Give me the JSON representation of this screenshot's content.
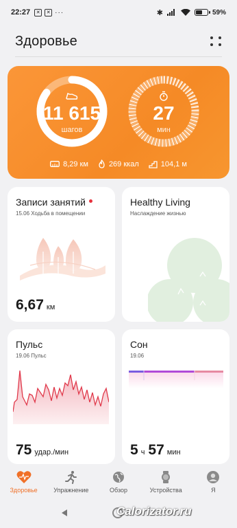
{
  "status_bar": {
    "time": "22:27",
    "battery": "59%",
    "battery_level": 0.59
  },
  "header": {
    "title": "Здоровье"
  },
  "activity": {
    "steps_value": "11 615",
    "steps_unit": "шагов",
    "minutes_value": "27",
    "minutes_unit": "мин",
    "distance": "8,29 км",
    "calories": "269 ккал",
    "floors": "104,1 м",
    "steps_progress": 0.85,
    "minutes_progress": 0.9,
    "accent": "#f58a26"
  },
  "workouts_card": {
    "title": "Записи занятий",
    "subtitle": "15.06 Ходьба в помещении",
    "value": "6,67",
    "unit": "км"
  },
  "healthy_card": {
    "title": "Healthy Living",
    "subtitle": "Наслаждение жизнью"
  },
  "pulse_card": {
    "title": "Пульс",
    "subtitle": "19.06 Пульс",
    "value": "75",
    "unit": "удар./мин"
  },
  "sleep_card": {
    "title": "Сон",
    "subtitle": "19.06",
    "hours": "5",
    "hours_unit": "ч",
    "minutes": "57",
    "minutes_unit": "мин"
  },
  "bottom_nav": {
    "items": [
      {
        "label": "Здоровье",
        "icon": "heart-icon",
        "active": true
      },
      {
        "label": "Упражнение",
        "icon": "runner-icon",
        "active": false
      },
      {
        "label": "Обзор",
        "icon": "globe-icon",
        "active": false
      },
      {
        "label": "Устройства",
        "icon": "watch-icon",
        "active": false
      },
      {
        "label": "Я",
        "icon": "profile-icon",
        "active": false
      }
    ]
  },
  "watermark": "Calorizator.ru",
  "colors": {
    "active_nav": "#f07028",
    "pulse_line": "#e0384a",
    "sleep_bar": "#b04ad8"
  }
}
